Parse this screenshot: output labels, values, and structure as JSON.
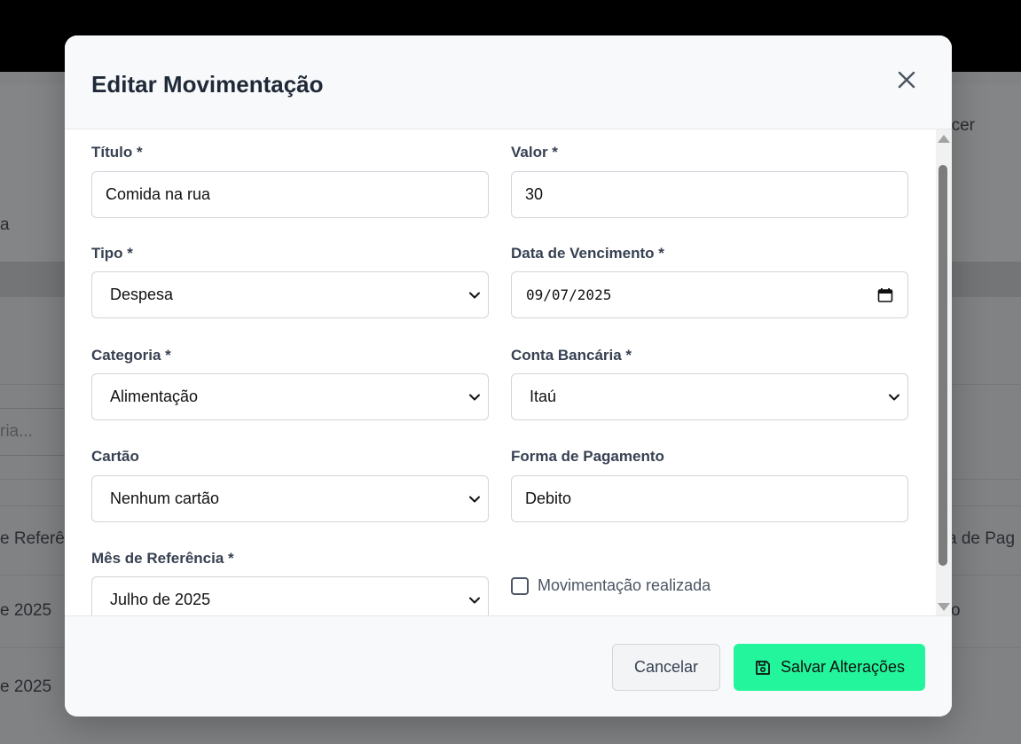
{
  "background": {
    "header_partial": "ncer",
    "label_partial": "a",
    "search_placeholder_partial": "ria...",
    "col_left_header": "e Referên",
    "col_right_header": "a de Pag",
    "row1_left": "e 2025",
    "row1_right": "o",
    "row2_left": "e 2025"
  },
  "modal": {
    "title": "Editar Movimentação",
    "close_icon": "close-icon",
    "fields": {
      "titulo": {
        "label": "Título *",
        "value": "Comida na rua"
      },
      "valor": {
        "label": "Valor *",
        "value": "30"
      },
      "tipo": {
        "label": "Tipo *",
        "value": "Despesa"
      },
      "data_vencimento": {
        "label": "Data de Vencimento *",
        "value": "09/07/2025"
      },
      "categoria": {
        "label": "Categoria *",
        "value": "Alimentação"
      },
      "conta_bancaria": {
        "label": "Conta Bancária *",
        "value": "Itaú"
      },
      "cartao": {
        "label": "Cartão",
        "value": "Nenhum cartão"
      },
      "forma_pagamento": {
        "label": "Forma de Pagamento",
        "value": "Debito"
      },
      "mes_referencia": {
        "label": "Mês de Referência *",
        "value": "Julho de 2025"
      }
    },
    "checkbox": {
      "label": "Movimentação realizada",
      "checked": false
    },
    "footer": {
      "cancel_label": "Cancelar",
      "save_label": "Salvar Alterações",
      "save_icon": "save-icon"
    }
  },
  "colors": {
    "accent": "#22f59b",
    "title_text": "#1f2937",
    "overlay": "#808284"
  }
}
